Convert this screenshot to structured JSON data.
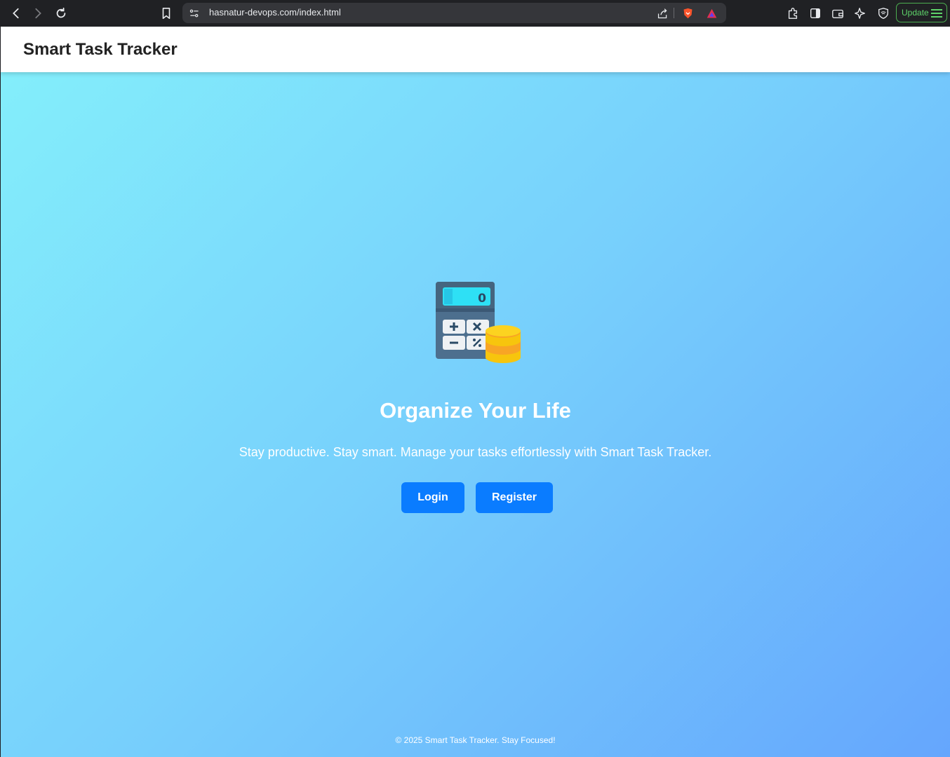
{
  "browser": {
    "url": "hasnatur-devops.com/index.html",
    "update_label": "Update",
    "icons": [
      "back-icon",
      "forward-icon",
      "reload-icon",
      "bookmark-icon",
      "site-info-icon",
      "share-icon",
      "brave-shield-icon",
      "brave-rewards-icon",
      "extensions-icon",
      "sidebar-icon",
      "wallet-icon",
      "leo-ai-icon",
      "vpn-icon",
      "menu-icon"
    ]
  },
  "header": {
    "brand": "Smart Task Tracker"
  },
  "hero": {
    "icon": "calculator-coins-icon",
    "title": "Organize Your Life",
    "subtitle": "Stay productive. Stay smart. Manage your tasks effortlessly with Smart Task Tracker.",
    "calculator_display": "0"
  },
  "actions": {
    "login_label": "Login",
    "register_label": "Register"
  },
  "footer": {
    "text": "© 2025 Smart Task Tracker. Stay Focused!"
  },
  "colors": {
    "primary": "#0a7cff",
    "gradient_start": "#84f0fb",
    "gradient_end": "#65a6fd",
    "update_green": "#5ed36a"
  }
}
